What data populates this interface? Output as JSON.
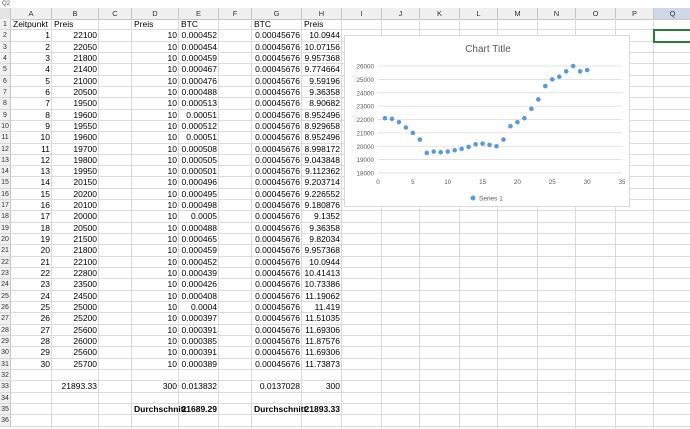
{
  "name_box": "Q2",
  "formula_text": "",
  "columns": [
    "A",
    "B",
    "C",
    "D",
    "E",
    "F",
    "G",
    "H",
    "I",
    "J",
    "K",
    "L",
    "M",
    "N",
    "O",
    "P",
    "Q"
  ],
  "selected_column": "Q",
  "row_numbers": [
    "1",
    "2",
    "3",
    "4",
    "5",
    "6",
    "7",
    "8",
    "9",
    "10",
    "11",
    "12",
    "13",
    "14",
    "15",
    "16",
    "17",
    "18",
    "19",
    "20",
    "21",
    "22",
    "23",
    "24",
    "25",
    "26",
    "27",
    "28",
    "29",
    "30",
    "31",
    "32",
    "33",
    "34",
    "35",
    "36"
  ],
  "headers": {
    "A1": "Zeitpunkt",
    "B1": "Preis",
    "D1": "Preis",
    "E1": "BTC",
    "G1": "BTC",
    "H1": "Preis"
  },
  "table_rows": [
    [
      "1",
      "22100",
      "10",
      "0.000452",
      "0.00045676",
      "10.0944"
    ],
    [
      "2",
      "22050",
      "10",
      "0.000454",
      "0.00045676",
      "10.07156"
    ],
    [
      "3",
      "21800",
      "10",
      "0.000459",
      "0.00045676",
      "9.957368"
    ],
    [
      "4",
      "21400",
      "10",
      "0.000467",
      "0.00045676",
      "9.774664"
    ],
    [
      "5",
      "21000",
      "10",
      "0.000476",
      "0.00045676",
      "9.59196"
    ],
    [
      "6",
      "20500",
      "10",
      "0.000488",
      "0.00045676",
      "9.36358"
    ],
    [
      "7",
      "19500",
      "10",
      "0.000513",
      "0.00045676",
      "8.90682"
    ],
    [
      "8",
      "19600",
      "10",
      "0.00051",
      "0.00045676",
      "8.952496"
    ],
    [
      "9",
      "19550",
      "10",
      "0.000512",
      "0.00045676",
      "8.929658"
    ],
    [
      "10",
      "19600",
      "10",
      "0.00051",
      "0.00045676",
      "8.952496"
    ],
    [
      "11",
      "19700",
      "10",
      "0.000508",
      "0.00045676",
      "8.998172"
    ],
    [
      "12",
      "19800",
      "10",
      "0.000505",
      "0.00045676",
      "9.043848"
    ],
    [
      "13",
      "19950",
      "10",
      "0.000501",
      "0.00045676",
      "9.112362"
    ],
    [
      "14",
      "20150",
      "10",
      "0.000496",
      "0.00045676",
      "9.203714"
    ],
    [
      "15",
      "20200",
      "10",
      "0.000495",
      "0.00045676",
      "9.226552"
    ],
    [
      "16",
      "20100",
      "10",
      "0.000498",
      "0.00045676",
      "9.180876"
    ],
    [
      "17",
      "20000",
      "10",
      "0.0005",
      "0.00045676",
      "9.1352"
    ],
    [
      "18",
      "20500",
      "10",
      "0.000488",
      "0.00045676",
      "9.36358"
    ],
    [
      "19",
      "21500",
      "10",
      "0.000465",
      "0.00045676",
      "9.82034"
    ],
    [
      "20",
      "21800",
      "10",
      "0.000459",
      "0.00045676",
      "9.957368"
    ],
    [
      "21",
      "22100",
      "10",
      "0.000452",
      "0.00045676",
      "10.0944"
    ],
    [
      "22",
      "22800",
      "10",
      "0.000439",
      "0.00045676",
      "10.41413"
    ],
    [
      "23",
      "23500",
      "10",
      "0.000426",
      "0.00045676",
      "10.73386"
    ],
    [
      "24",
      "24500",
      "10",
      "0.000408",
      "0.00045676",
      "11.19062"
    ],
    [
      "25",
      "25000",
      "10",
      "0.0004",
      "0.00045676",
      "11.419"
    ],
    [
      "26",
      "25200",
      "10",
      "0.000397",
      "0.00045676",
      "11.51035"
    ],
    [
      "27",
      "25600",
      "10",
      "0.000391",
      "0.00045676",
      "11.69306"
    ],
    [
      "28",
      "26000",
      "10",
      "0.000385",
      "0.00045676",
      "11.87576"
    ],
    [
      "29",
      "25600",
      "10",
      "0.000391",
      "0.00045676",
      "11.69306"
    ],
    [
      "30",
      "25700",
      "10",
      "0.000389",
      "0.00045676",
      "11.73873"
    ]
  ],
  "summary": {
    "B33": "21893.33",
    "D33": "300",
    "E33": "0.013832",
    "G33": "0.0137028",
    "H33": "300",
    "D35": "Durchschnitt",
    "E35": "21689.29",
    "G35": "Durchschnitt",
    "H35": "21893.33"
  },
  "chart_data": {
    "type": "scatter",
    "title": "Chart Title",
    "xlabel": "",
    "ylabel": "",
    "xlim": [
      0,
      35
    ],
    "ylim": [
      18000,
      26000
    ],
    "x_ticks": [
      "0",
      "5",
      "10",
      "15",
      "20",
      "25",
      "30",
      "35"
    ],
    "y_ticks": [
      "18000",
      "19000",
      "20000",
      "21000",
      "22000",
      "23000",
      "24000",
      "25000",
      "26000"
    ],
    "grid": true,
    "legend_position": "bottom",
    "marker_color": "#5b9bd5",
    "series": [
      {
        "name": "Series 1",
        "x": [
          1,
          2,
          3,
          4,
          5,
          6,
          7,
          8,
          9,
          10,
          11,
          12,
          13,
          14,
          15,
          16,
          17,
          18,
          19,
          20,
          21,
          22,
          23,
          24,
          25,
          26,
          27,
          28,
          29,
          30
        ],
        "y": [
          22100,
          22050,
          21800,
          21400,
          21000,
          20500,
          19500,
          19600,
          19550,
          19600,
          19700,
          19800,
          19950,
          20150,
          20200,
          20100,
          20000,
          20500,
          21500,
          21800,
          22100,
          22800,
          23500,
          24500,
          25000,
          25200,
          25600,
          26000,
          25600,
          25700
        ]
      }
    ]
  }
}
